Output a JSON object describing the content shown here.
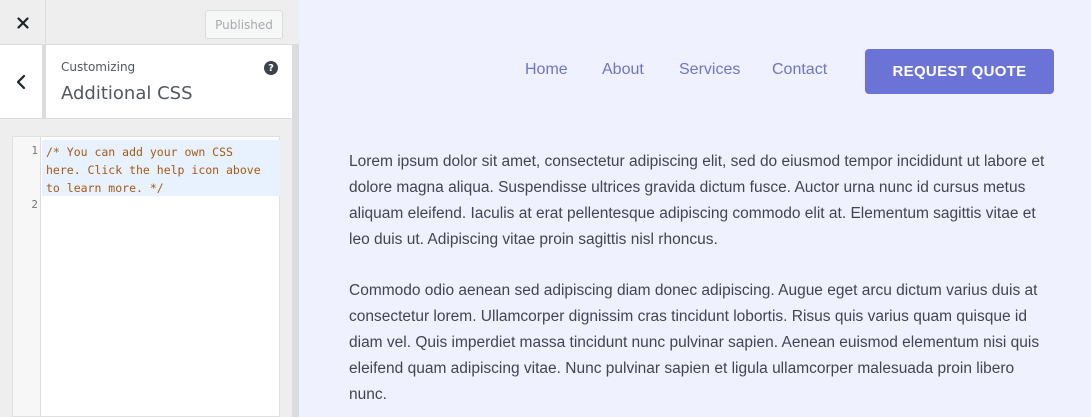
{
  "topbar": {
    "close_icon": "close-icon",
    "published_label": "Published"
  },
  "panel": {
    "back_icon": "chevron-left-icon",
    "subtitle": "Customizing",
    "title": "Additional CSS",
    "help_icon": "help-icon",
    "help_glyph": "?"
  },
  "editor": {
    "line_numbers": [
      "1",
      "2"
    ],
    "lines": [
      "/* You can add your own CSS\nhere. Click the help icon above\nto learn more. */",
      ""
    ]
  },
  "site": {
    "nav": [
      {
        "label": "Home"
      },
      {
        "label": "About"
      },
      {
        "label": "Services"
      },
      {
        "label": "Contact"
      }
    ],
    "cta_label": "REQUEST QUOTE",
    "paragraphs": [
      "Lorem ipsum dolor sit amet, consectetur adipiscing elit, sed do eiusmod tempor incididunt ut labore et dolore magna aliqua. Suspendisse ultrices gravida dictum fusce. Auctor urna nunc id cursus metus aliquam eleifend. Iaculis at erat pellentesque adipiscing commodo elit at. Elementum sagittis vitae et leo duis ut. Adipiscing vitae proin sagittis nisl rhoncus.",
      "Commodo odio aenean sed adipiscing diam donec adipiscing. Augue eget arcu dictum varius duis at consectetur lorem. Ullamcorper dignissim cras tincidunt lobortis. Risus quis varius quam quisque id diam vel. Quis imperdiet massa tincidunt nunc pulvinar sapien. Aenean euismod elementum nisi quis eleifend quam adipiscing vitae. Nunc pulvinar sapien et ligula ullamcorper malesuada proin libero nunc."
    ]
  },
  "colors": {
    "accent": "#6b74d6",
    "nav_link": "#6e76c4",
    "preview_bg": "#eff1fe",
    "code_comment": "#a85810"
  }
}
